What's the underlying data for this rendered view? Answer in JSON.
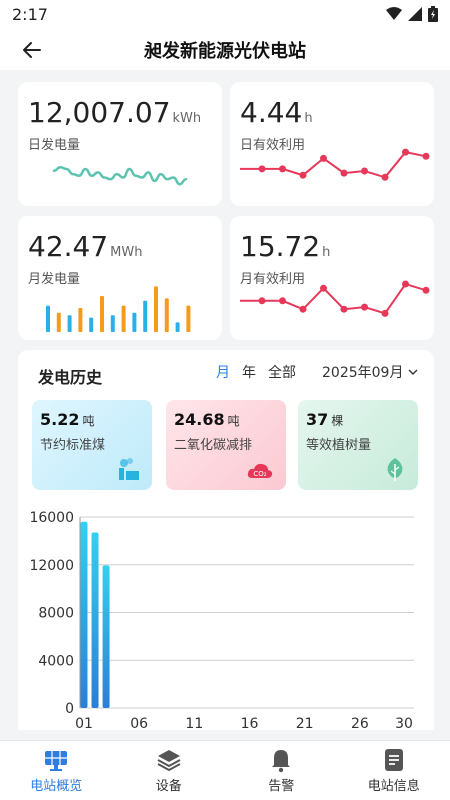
{
  "status": {
    "time": "2:17"
  },
  "appbar": {
    "title": "昶发新能源光伏电站"
  },
  "metrics": {
    "daily_energy": {
      "value": "12,007.07",
      "unit": "kWh",
      "label": "日发电量",
      "sparkline": [
        0.45,
        0.55,
        0.5,
        0.35,
        0.3,
        0.5,
        0.3,
        0.4,
        0.25,
        0.2,
        0.35,
        0.25,
        0.5,
        0.3,
        0.25,
        0.4,
        0.15,
        0.35,
        0.2,
        0.25,
        0.05,
        0.2
      ]
    },
    "daily_hours": {
      "value": "4.44",
      "unit": "h",
      "label": "日有效利用",
      "points": [
        0.45,
        0.45,
        0.6,
        0.2,
        0.55,
        0.5,
        0.65,
        0.05,
        0.15
      ]
    },
    "monthly_energy": {
      "value": "42.47",
      "unit": "MWh",
      "label": "月发电量",
      "bars": [
        0.55,
        0.4,
        0.35,
        0.5,
        0.3,
        0.75,
        0.35,
        0.55,
        0.4,
        0.65,
        0.95,
        0.7,
        0.2,
        0.55
      ]
    },
    "monthly_hours": {
      "value": "15.72",
      "unit": "h",
      "label": "月有效利用",
      "points": [
        0.4,
        0.4,
        0.6,
        0.1,
        0.6,
        0.55,
        0.7,
        0.0,
        0.15
      ]
    }
  },
  "history": {
    "title": "发电历史",
    "tabs": [
      "月",
      "年",
      "全部"
    ],
    "active_tab": "月",
    "month": "2025年09月",
    "summary": [
      {
        "value": "5.22",
        "unit": "吨",
        "label": "节约标准煤",
        "icon": "factory-icon"
      },
      {
        "value": "24.68",
        "unit": "吨",
        "label": "二氧化碳减排",
        "icon": "co2-cloud-icon",
        "icon_text": "CO₂"
      },
      {
        "value": "37",
        "unit": "棵",
        "label": "等效植树量",
        "icon": "leaf-icon"
      }
    ]
  },
  "chart_data": {
    "type": "bar",
    "title": "",
    "xlabel": "",
    "ylabel": "",
    "ylim": [
      0,
      16000
    ],
    "y_ticks": [
      "0",
      "4000",
      "8000",
      "12000",
      "16000"
    ],
    "x_ticks": [
      "01",
      "06",
      "11",
      "16",
      "21",
      "26",
      "30"
    ],
    "x": [
      1,
      2,
      3
    ],
    "values": [
      15600,
      14700,
      11950
    ],
    "bar_color": "#2ba3e0",
    "grid": true
  },
  "nav": {
    "items": [
      {
        "label": "电站概览",
        "icon": "solar-panel-icon",
        "active": true
      },
      {
        "label": "设备",
        "icon": "layers-icon",
        "active": false
      },
      {
        "label": "告警",
        "icon": "bell-icon",
        "active": false
      },
      {
        "label": "电站信息",
        "icon": "document-icon",
        "active": false
      }
    ]
  },
  "colors": {
    "accent": "#2f7de1",
    "teal": "#5cc3b0",
    "red": "#e6395a",
    "orange": "#f59b1b",
    "blue": "#2ab0e8"
  }
}
